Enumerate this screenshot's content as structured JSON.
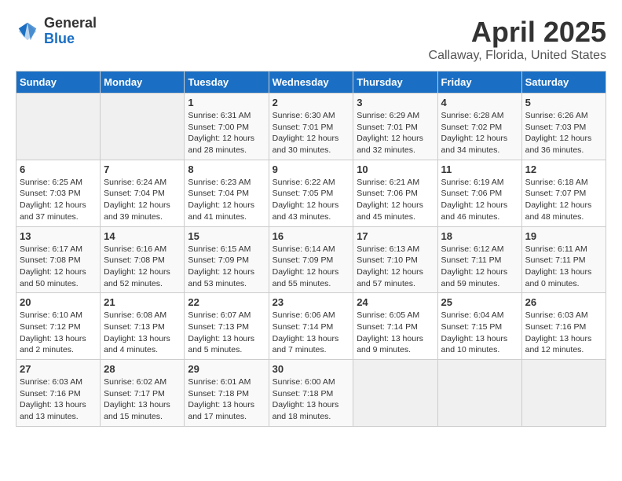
{
  "header": {
    "logo_general": "General",
    "logo_blue": "Blue",
    "title": "April 2025",
    "subtitle": "Callaway, Florida, United States"
  },
  "weekdays": [
    "Sunday",
    "Monday",
    "Tuesday",
    "Wednesday",
    "Thursday",
    "Friday",
    "Saturday"
  ],
  "weeks": [
    [
      {
        "day": "",
        "info": ""
      },
      {
        "day": "",
        "info": ""
      },
      {
        "day": "1",
        "info": "Sunrise: 6:31 AM\nSunset: 7:00 PM\nDaylight: 12 hours\nand 28 minutes."
      },
      {
        "day": "2",
        "info": "Sunrise: 6:30 AM\nSunset: 7:01 PM\nDaylight: 12 hours\nand 30 minutes."
      },
      {
        "day": "3",
        "info": "Sunrise: 6:29 AM\nSunset: 7:01 PM\nDaylight: 12 hours\nand 32 minutes."
      },
      {
        "day": "4",
        "info": "Sunrise: 6:28 AM\nSunset: 7:02 PM\nDaylight: 12 hours\nand 34 minutes."
      },
      {
        "day": "5",
        "info": "Sunrise: 6:26 AM\nSunset: 7:03 PM\nDaylight: 12 hours\nand 36 minutes."
      }
    ],
    [
      {
        "day": "6",
        "info": "Sunrise: 6:25 AM\nSunset: 7:03 PM\nDaylight: 12 hours\nand 37 minutes."
      },
      {
        "day": "7",
        "info": "Sunrise: 6:24 AM\nSunset: 7:04 PM\nDaylight: 12 hours\nand 39 minutes."
      },
      {
        "day": "8",
        "info": "Sunrise: 6:23 AM\nSunset: 7:04 PM\nDaylight: 12 hours\nand 41 minutes."
      },
      {
        "day": "9",
        "info": "Sunrise: 6:22 AM\nSunset: 7:05 PM\nDaylight: 12 hours\nand 43 minutes."
      },
      {
        "day": "10",
        "info": "Sunrise: 6:21 AM\nSunset: 7:06 PM\nDaylight: 12 hours\nand 45 minutes."
      },
      {
        "day": "11",
        "info": "Sunrise: 6:19 AM\nSunset: 7:06 PM\nDaylight: 12 hours\nand 46 minutes."
      },
      {
        "day": "12",
        "info": "Sunrise: 6:18 AM\nSunset: 7:07 PM\nDaylight: 12 hours\nand 48 minutes."
      }
    ],
    [
      {
        "day": "13",
        "info": "Sunrise: 6:17 AM\nSunset: 7:08 PM\nDaylight: 12 hours\nand 50 minutes."
      },
      {
        "day": "14",
        "info": "Sunrise: 6:16 AM\nSunset: 7:08 PM\nDaylight: 12 hours\nand 52 minutes."
      },
      {
        "day": "15",
        "info": "Sunrise: 6:15 AM\nSunset: 7:09 PM\nDaylight: 12 hours\nand 53 minutes."
      },
      {
        "day": "16",
        "info": "Sunrise: 6:14 AM\nSunset: 7:09 PM\nDaylight: 12 hours\nand 55 minutes."
      },
      {
        "day": "17",
        "info": "Sunrise: 6:13 AM\nSunset: 7:10 PM\nDaylight: 12 hours\nand 57 minutes."
      },
      {
        "day": "18",
        "info": "Sunrise: 6:12 AM\nSunset: 7:11 PM\nDaylight: 12 hours\nand 59 minutes."
      },
      {
        "day": "19",
        "info": "Sunrise: 6:11 AM\nSunset: 7:11 PM\nDaylight: 13 hours\nand 0 minutes."
      }
    ],
    [
      {
        "day": "20",
        "info": "Sunrise: 6:10 AM\nSunset: 7:12 PM\nDaylight: 13 hours\nand 2 minutes."
      },
      {
        "day": "21",
        "info": "Sunrise: 6:08 AM\nSunset: 7:13 PM\nDaylight: 13 hours\nand 4 minutes."
      },
      {
        "day": "22",
        "info": "Sunrise: 6:07 AM\nSunset: 7:13 PM\nDaylight: 13 hours\nand 5 minutes."
      },
      {
        "day": "23",
        "info": "Sunrise: 6:06 AM\nSunset: 7:14 PM\nDaylight: 13 hours\nand 7 minutes."
      },
      {
        "day": "24",
        "info": "Sunrise: 6:05 AM\nSunset: 7:14 PM\nDaylight: 13 hours\nand 9 minutes."
      },
      {
        "day": "25",
        "info": "Sunrise: 6:04 AM\nSunset: 7:15 PM\nDaylight: 13 hours\nand 10 minutes."
      },
      {
        "day": "26",
        "info": "Sunrise: 6:03 AM\nSunset: 7:16 PM\nDaylight: 13 hours\nand 12 minutes."
      }
    ],
    [
      {
        "day": "27",
        "info": "Sunrise: 6:03 AM\nSunset: 7:16 PM\nDaylight: 13 hours\nand 13 minutes."
      },
      {
        "day": "28",
        "info": "Sunrise: 6:02 AM\nSunset: 7:17 PM\nDaylight: 13 hours\nand 15 minutes."
      },
      {
        "day": "29",
        "info": "Sunrise: 6:01 AM\nSunset: 7:18 PM\nDaylight: 13 hours\nand 17 minutes."
      },
      {
        "day": "30",
        "info": "Sunrise: 6:00 AM\nSunset: 7:18 PM\nDaylight: 13 hours\nand 18 minutes."
      },
      {
        "day": "",
        "info": ""
      },
      {
        "day": "",
        "info": ""
      },
      {
        "day": "",
        "info": ""
      }
    ]
  ]
}
